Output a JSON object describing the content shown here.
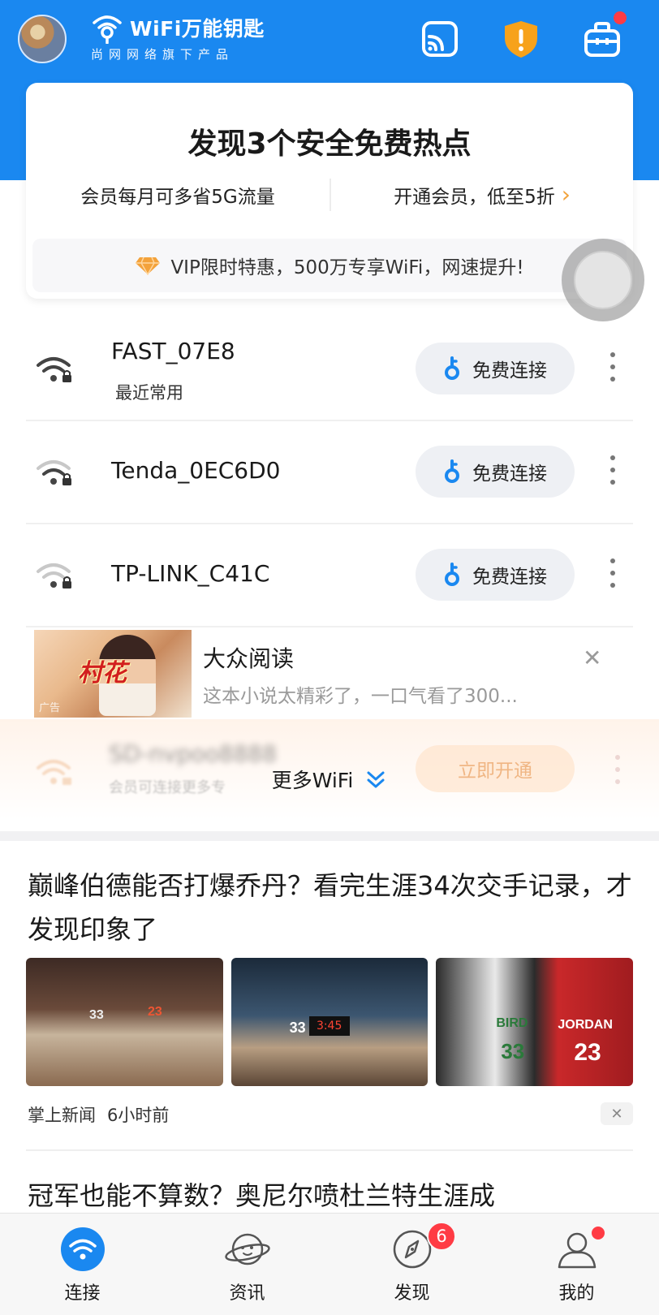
{
  "header": {
    "app_title": "WiFi万能钥匙",
    "subtitle": "尚网网络旗下产品",
    "icons": [
      "wifi-logo-icon",
      "cast-icon",
      "shield-alert-icon",
      "toolbox-icon"
    ],
    "colors": {
      "primary": "#1a88f0",
      "alert": "#f7a21b",
      "badge": "#ff3b44"
    }
  },
  "hero": {
    "title": "发现3个安全免费热点",
    "left_text": "会员每月可多省5G流量",
    "right_text": "开通会员，低至5折",
    "vip_text": "VIP限时特惠，500万专享WiFi，网速提升!"
  },
  "wifi_list": [
    {
      "name": "FAST_07E8",
      "sub": "最近常用",
      "button": "免费连接"
    },
    {
      "name": "Tenda_0EC6D0",
      "sub": "",
      "button": "免费连接"
    },
    {
      "name": "TP-LINK_C41C",
      "sub": "",
      "button": "免费连接"
    }
  ],
  "ad": {
    "image_text": "村花",
    "ad_label": "广告",
    "title": "大众阅读",
    "desc": "这本小说太精彩了，一口气看了300..."
  },
  "locked": {
    "name": "SD-nvpoo8888",
    "sub": "会员可连接更多专",
    "button": "立即开通"
  },
  "more_wifi": "更多WiFi",
  "news": [
    {
      "title": "巅峰伯德能否打爆乔丹？看完生涯34次交手记录，才发现印象了",
      "source": "掌上新闻",
      "time": "6小时前",
      "img_texts": {
        "jersey_a": "33",
        "jersey_b": "23",
        "name_a": "BIRD",
        "name_b": "JORDAN",
        "score": "3:45"
      }
    },
    {
      "title": "冠军也能不算数？奥尼尔喷杜兰特生涯成"
    }
  ],
  "tabs": [
    {
      "label": "连接",
      "icon": "wifi-tab-icon",
      "active": true
    },
    {
      "label": "资讯",
      "icon": "planet-tab-icon",
      "active": false
    },
    {
      "label": "发现",
      "icon": "compass-tab-icon",
      "badge": "6",
      "active": false
    },
    {
      "label": "我的",
      "icon": "person-tab-icon",
      "active": false,
      "dot": true
    }
  ]
}
